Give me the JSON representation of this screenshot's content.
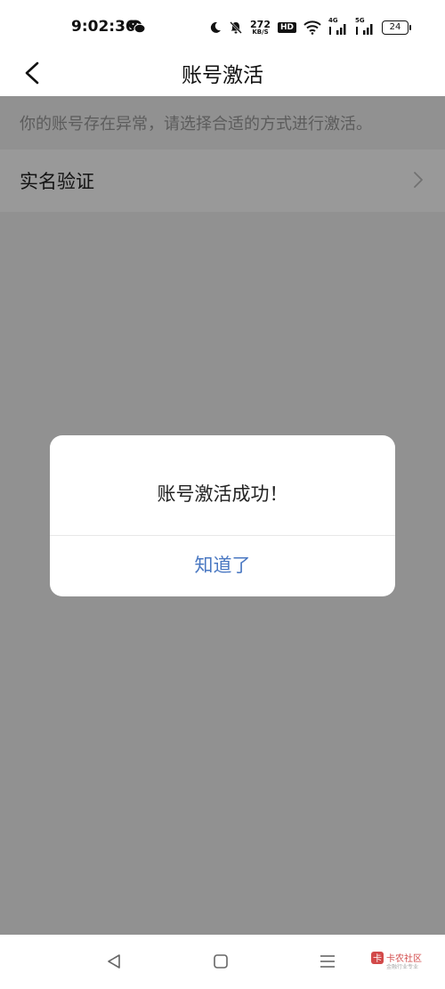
{
  "status_bar": {
    "time": "9:02:36",
    "net_speed": "272",
    "net_unit": "KB/S",
    "hd": "HD",
    "sig1": "4G",
    "sig2": "5G",
    "battery": "24",
    "icons": [
      "wechat-icon",
      "moon-icon",
      "mute-bell-icon",
      "wifi-icon",
      "signal-icon",
      "battery-icon"
    ]
  },
  "header": {
    "title": "账号激活"
  },
  "main": {
    "notice": "你的账号存在异常，请选择合适的方式进行激活。",
    "options": [
      {
        "label": "实名验证"
      }
    ]
  },
  "dialog": {
    "message": "账号激活成功！",
    "button": "知道了"
  },
  "watermark": {
    "text": "卡农社区",
    "sub": "金融行业专业"
  },
  "colors": {
    "accent": "#4a78c2",
    "overlay": "rgba(0,0,0,0.40)",
    "background": "#f2f2f2"
  }
}
